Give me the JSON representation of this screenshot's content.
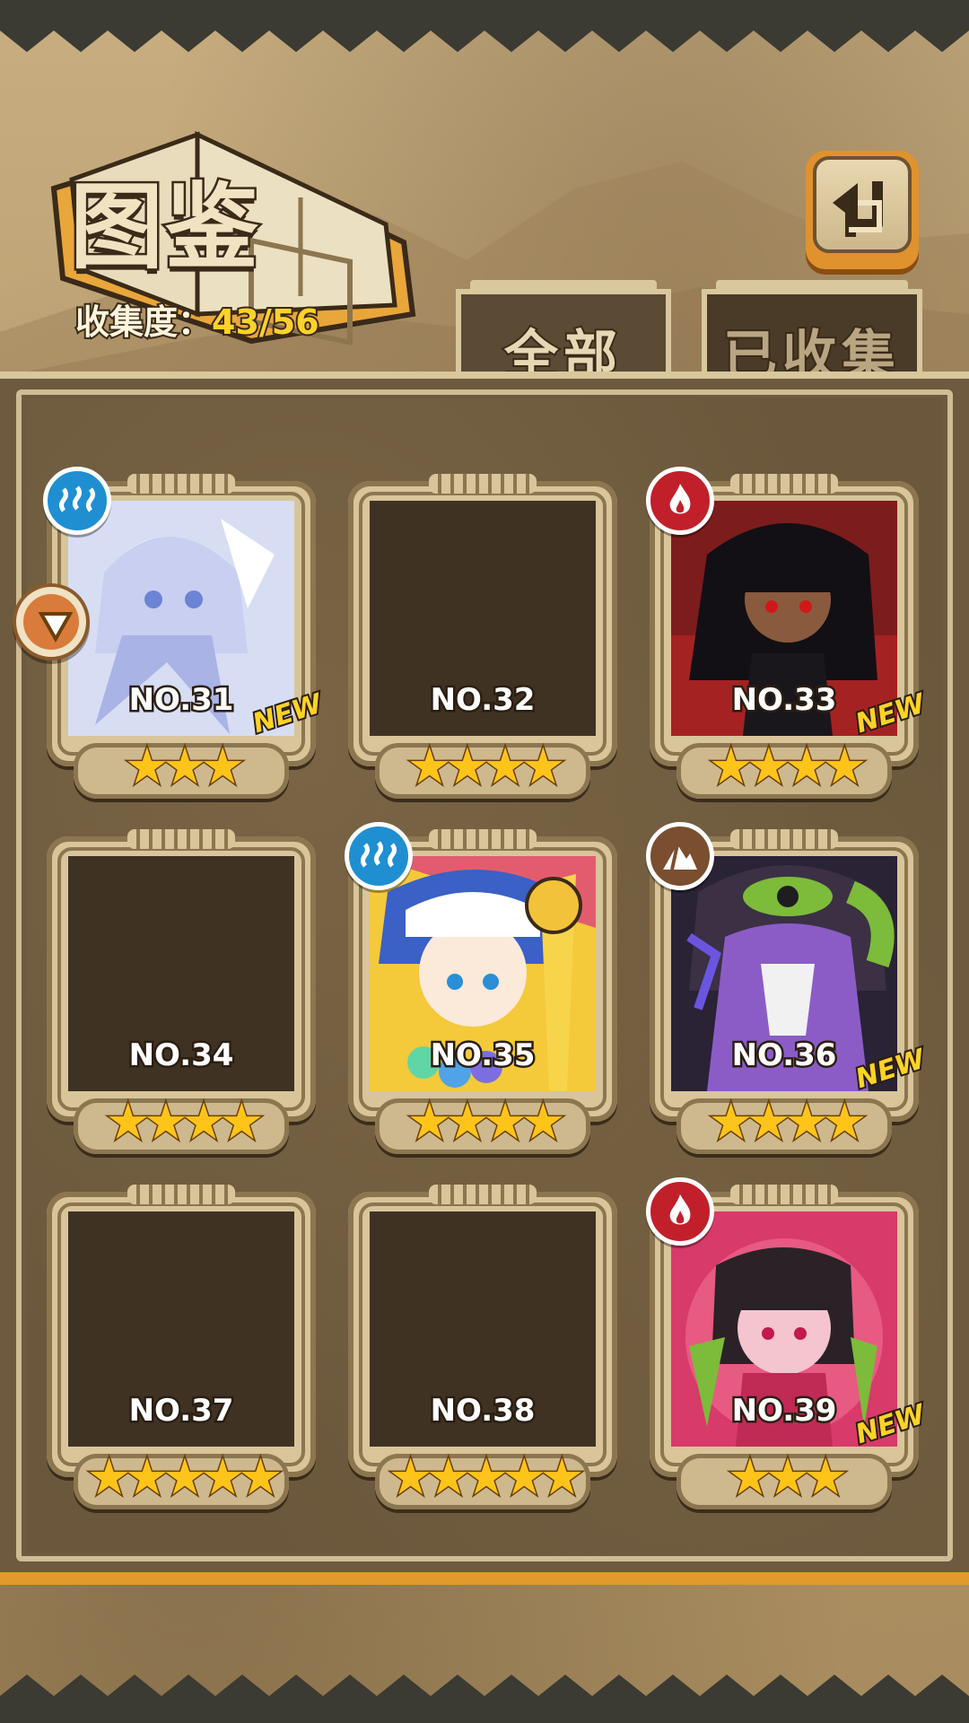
{
  "header": {
    "title": "图鉴",
    "collection_label": "收集度：",
    "collection_value": "43/56"
  },
  "tabs": [
    {
      "label": "全部",
      "active": true
    },
    {
      "label": "已收集",
      "active": false
    }
  ],
  "back_button": {
    "icon": "back-arrow-icon"
  },
  "side_badge": {
    "icon": "pointer-badge-icon"
  },
  "colors": {
    "accent_orange": "#e39a2c",
    "star_gold": "#ffc41a",
    "new_yellow": "#ffd326",
    "water": "#1f8fd1",
    "fire": "#c1202a",
    "earth": "#7a4e2e"
  },
  "cards": [
    {
      "number": "NO.31",
      "stars": "★★★",
      "element": "water",
      "element_icon": "water-element-icon",
      "collected": true,
      "is_new": true,
      "new_label": "NEW",
      "theme": "ice"
    },
    {
      "number": "NO.32",
      "stars": "★★★★",
      "element": "",
      "element_icon": "",
      "collected": false,
      "is_new": false,
      "new_label": "",
      "theme": "silhouette"
    },
    {
      "number": "NO.33",
      "stars": "★★★★",
      "element": "fire",
      "element_icon": "fire-element-icon",
      "collected": true,
      "is_new": true,
      "new_label": "NEW",
      "theme": "dark"
    },
    {
      "number": "NO.34",
      "stars": "★★★★",
      "element": "",
      "element_icon": "",
      "collected": false,
      "is_new": false,
      "new_label": "",
      "theme": "silhouette"
    },
    {
      "number": "NO.35",
      "stars": "★★★★",
      "element": "water",
      "element_icon": "water-element-icon",
      "collected": true,
      "is_new": false,
      "new_label": "",
      "theme": "colorful"
    },
    {
      "number": "NO.36",
      "stars": "★★★★",
      "element": "earth",
      "element_icon": "earth-element-icon",
      "collected": true,
      "is_new": true,
      "new_label": "NEW",
      "theme": "purple"
    },
    {
      "number": "NO.37",
      "stars": "★★★★★",
      "element": "",
      "element_icon": "",
      "collected": false,
      "is_new": false,
      "new_label": "",
      "theme": "silhouette"
    },
    {
      "number": "NO.38",
      "stars": "★★★★★",
      "element": "",
      "element_icon": "",
      "collected": false,
      "is_new": false,
      "new_label": "",
      "theme": "silhouette"
    },
    {
      "number": "NO.39",
      "stars": "★★★",
      "element": "fire",
      "element_icon": "fire-element-icon",
      "collected": true,
      "is_new": true,
      "new_label": "NEW",
      "theme": "pink"
    }
  ]
}
